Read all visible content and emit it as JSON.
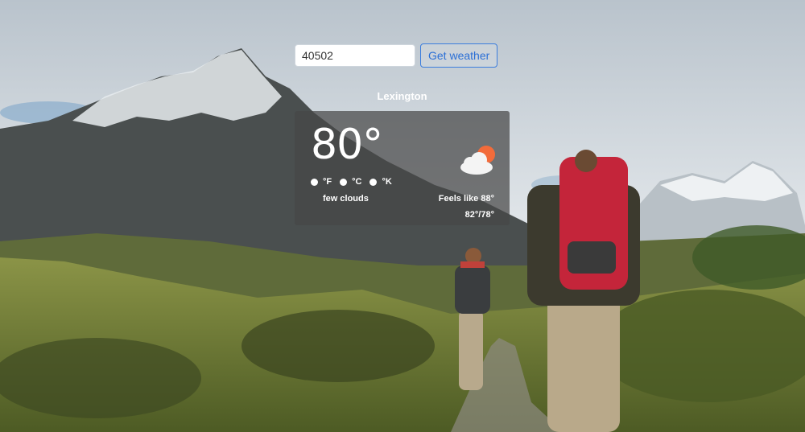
{
  "search": {
    "zip_value": "40502",
    "button_label": "Get weather"
  },
  "weather": {
    "city": "Lexington",
    "temperature": "80°",
    "units": [
      {
        "label": "°F"
      },
      {
        "label": "°C"
      },
      {
        "label": "°K"
      }
    ],
    "description": "few clouds",
    "feels_like": "Feels like 88°",
    "high_low": "82°/78°",
    "icon": "few-clouds-icon"
  },
  "colors": {
    "button_accent": "#3b7ddd",
    "card_bg": "rgba(70,70,70,0.72)",
    "sun": "#f26b3a"
  }
}
